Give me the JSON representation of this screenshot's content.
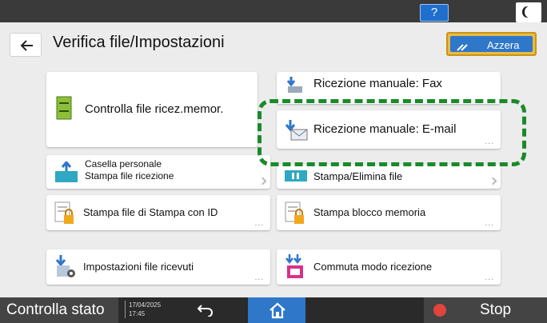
{
  "topbar": {
    "help_label": "?",
    "icons": {
      "help": "question-icon",
      "theme": "moon-icon"
    }
  },
  "header": {
    "title": "Verifica file/Impostazioni",
    "reset_label": "Azzera"
  },
  "tiles": {
    "controlla_file": "Controlla file ricez.memor.",
    "ricezione_fax": "Ricezione manuale: Fax",
    "ricezione_email": "Ricezione manuale: E-mail",
    "casella_line1": "Casella personale",
    "casella_line2": "Stampa file ricezione",
    "stampa_elimina": "Stampa/Elimina file",
    "stampa_id": "Stampa file di Stampa con ID",
    "stampa_blocco": "Stampa blocco memoria",
    "impostazioni_ricevuti": "Impostazioni file ricevuti",
    "commuta_modo": "Commuta modo ricezione",
    "more_dots": "..."
  },
  "bottombar": {
    "status_label": "Controlla stato",
    "date": "17/04/2025",
    "time": "17:45",
    "stop_label": "Stop"
  },
  "colors": {
    "accent_blue": "#2e77c9",
    "highlight_green": "#1a8a2b",
    "reset_gold": "#e8bb4a",
    "stop_red": "#e0443a"
  }
}
